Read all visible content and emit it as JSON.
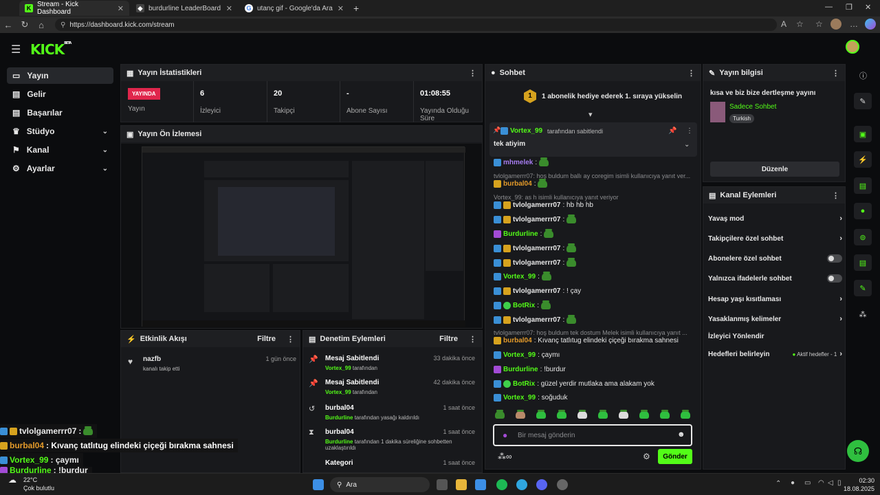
{
  "browser": {
    "tabs": [
      {
        "title": "Stream - Kick Dashboard"
      },
      {
        "title": "burdurline LeaderBoard | The bes"
      },
      {
        "title": "utanç gif - Google'da Ara"
      }
    ],
    "url": "https://dashboard.kick.com/stream"
  },
  "brand": {
    "logo": "KICK",
    "beta": "BETA",
    "accent": "#53fc18"
  },
  "nav": {
    "items": [
      {
        "label": "Yayın"
      },
      {
        "label": "Gelir"
      },
      {
        "label": "Başarılar"
      },
      {
        "label": "Stüdyo"
      },
      {
        "label": "Kanal"
      },
      {
        "label": "Ayarlar"
      }
    ]
  },
  "stats": {
    "title": "Yayın İstatistikleri",
    "live_badge": "YAYINDA",
    "items": [
      {
        "value": "",
        "label": "Yayın"
      },
      {
        "value": "6",
        "label": "İzleyici"
      },
      {
        "value": "20",
        "label": "Takipçi"
      },
      {
        "value": "-",
        "label": "Abone Sayısı"
      },
      {
        "value": "01:08:55",
        "label": "Yayında Olduğu Süre"
      }
    ]
  },
  "preview": {
    "title": "Yayın Ön İzlemesi"
  },
  "activity": {
    "title": "Etkinlik Akışı",
    "filter": "Filtre",
    "items": [
      {
        "user": "nazfb",
        "text": "kanalı takip etti",
        "time": "1 gün önce"
      }
    ]
  },
  "moderation": {
    "title": "Denetim Eylemleri",
    "filter": "Filtre",
    "items": [
      {
        "title": "Mesaj Sabitlendi",
        "user": "Vortex_99",
        "text": "tarafından",
        "time": "33 dakika önce"
      },
      {
        "title": "Mesaj Sabitlendi",
        "user": "Vortex_99",
        "text": "tarafından",
        "time": "42 dakika önce"
      },
      {
        "title": "burbal04",
        "user": "Burdurline",
        "text": "tarafından yasağı kaldırıldı",
        "time": "1 saat önce"
      },
      {
        "title": "burbal04",
        "user": "Burdurline",
        "text": "tarafından 1 dakika süreliğine sohbetten uzaklaştırıldı",
        "time": "1 saat önce"
      },
      {
        "title": "Kategori",
        "user": "",
        "text": "",
        "time": "1 saat önce"
      }
    ]
  },
  "chat": {
    "title": "Sohbet",
    "gift_banner": "1 abonelik hediye ederek 1. sıraya yükselin",
    "gift_rank": "1",
    "pinned": {
      "user": "Vortex_99",
      "by": "tarafından sabitlendi",
      "message": "tek atiyim"
    },
    "messages": [
      {
        "type": "msg",
        "user": "mhmelek",
        "text": ":",
        "color": "#a57cf0"
      },
      {
        "type": "sys",
        "text": "tvlolgamerrr07: hoş buldum ballı ay coregim isimli kullanıcıya yanıt ver..."
      },
      {
        "type": "msg",
        "user": "burbal04",
        "text": ":",
        "color": "#e39a2a"
      },
      {
        "type": "sys",
        "text": "Vortex_99: as h isimli kullanıcıya yanıt veriyor"
      },
      {
        "type": "msg",
        "user": "tvlolgamerrr07",
        "text": ": hb hb hb",
        "color": "#e8e8e8"
      },
      {
        "type": "msg",
        "user": "tvlolgamerrr07",
        "text": ":",
        "color": "#e8e8e8"
      },
      {
        "type": "msg",
        "user": "Burdurline",
        "text": ":",
        "color": "#53fc18"
      },
      {
        "type": "msg",
        "user": "tvlolgamerrr07",
        "text": ":",
        "color": "#e8e8e8"
      },
      {
        "type": "msg",
        "user": "tvlolgamerrr07",
        "text": ":",
        "color": "#e8e8e8"
      },
      {
        "type": "msg",
        "user": "Vortex_99",
        "text": ":",
        "color": "#53fc18"
      },
      {
        "type": "msg",
        "user": "tvlolgamerrr07",
        "text": ": ! çay",
        "color": "#e8e8e8"
      },
      {
        "type": "msg",
        "user": "BotRix",
        "text": ":",
        "color": "#53fc18"
      },
      {
        "type": "msg",
        "user": "tvlolgamerrr07",
        "text": ":",
        "color": "#e8e8e8"
      },
      {
        "type": "sys",
        "text": "tvlolgamerrr07: hoş buldum tek dostum Melek isimli kullanıcıya yanıt ..."
      },
      {
        "type": "msg",
        "user": "burbal04",
        "text": ": Kıvanç tatlıtug elindeki çiçeği bırakma sahnesi",
        "color": "#e39a2a"
      },
      {
        "type": "msg",
        "user": "Vortex_99",
        "text": ": çaymı",
        "color": "#53fc18"
      },
      {
        "type": "msg",
        "user": "Burdurline",
        "text": ": !burdur",
        "color": "#53fc18"
      },
      {
        "type": "msg",
        "user": "BotRix",
        "text": ": güzel yerdir mutlaka ama alakam yok",
        "color": "#53fc18"
      },
      {
        "type": "msg",
        "user": "Vortex_99",
        "text": ": soğuduk",
        "color": "#53fc18"
      }
    ],
    "input_placeholder": "Bir mesaj gönderin",
    "send": "Gönder"
  },
  "info": {
    "title": "Yayın bilgisi",
    "stream_title": "kısa ve biz bize dertleşme yayını",
    "category": "Sadece Sohbet",
    "tag": "Turkish",
    "edit": "Düzenle"
  },
  "channel_actions": {
    "title": "Kanal Eylemleri",
    "items": [
      {
        "label": "Yavaş mod",
        "kind": "arrow"
      },
      {
        "label": "Takipçilere özel sohbet",
        "kind": "arrow"
      },
      {
        "label": "Abonelere özel sohbet",
        "kind": "toggle"
      },
      {
        "label": "Yalnızca ifadelerle sohbet",
        "kind": "toggle"
      },
      {
        "label": "Hesap yaşı kısıtlaması",
        "kind": "arrow"
      },
      {
        "label": "Yasaklanmış kelimeler",
        "kind": "arrow"
      },
      {
        "label": "İzleyici Yönlendir",
        "kind": "none"
      },
      {
        "label": "Hedefleri belirleyin",
        "kind": "arrow",
        "extra": "Aktif hedefler - 1"
      }
    ]
  },
  "overlay": [
    {
      "user": "tvlolgamerrr07",
      "text": " :",
      "color": "#e8e8e8"
    },
    {
      "user": "burbal04",
      "text": ": Kıvanç tatlıtug elindeki çiçeği bırakma sahnesi",
      "color": "#e39a2a"
    },
    {
      "user": "Vortex_99",
      "text": ": çaymı",
      "color": "#53fc18"
    },
    {
      "user": "Burdurline",
      "text": ": !burdur",
      "color": "#53fc18"
    }
  ],
  "taskbar": {
    "weather_temp": "22°C",
    "weather_text": "Çok bulutlu",
    "search": "Ara",
    "time": "02:30",
    "date": "18.08.2025"
  }
}
